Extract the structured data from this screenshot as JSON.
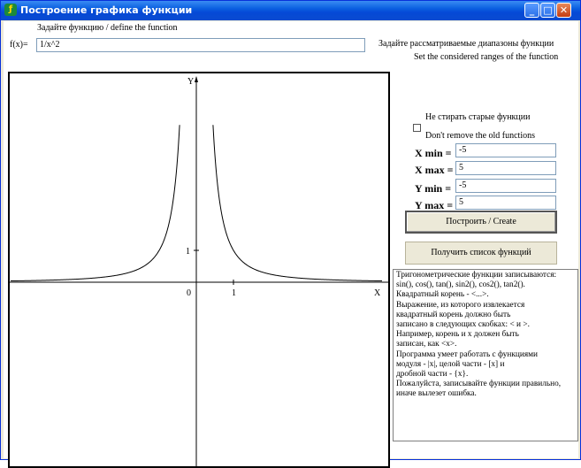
{
  "window": {
    "title": "Построение графика функции",
    "app_icon": "app-icon",
    "minimize_glyph": "_",
    "maximize_glyph": "□",
    "close_glyph": "✕"
  },
  "function": {
    "prompt": "Задайте функцию / define the function",
    "label": "f(x)=",
    "value": "1/x^2"
  },
  "ranges": {
    "heading_ru": "Задайте рассматриваемые диапазоны функции",
    "heading_en": "Set the considered ranges of the function",
    "keep_old_ru": "Не стирать старые функции",
    "keep_old_en": "Don't remove the old functions",
    "keep_old_checked": false,
    "xmin_label": "X min =",
    "xmin": "-5",
    "xmax_label": "X max =",
    "xmax": "5",
    "ymin_label": "Y min =",
    "ymin": "-5",
    "ymax_label": "Y max =",
    "ymax": "5"
  },
  "buttons": {
    "create": "Построить / Create",
    "list": "Получить список функций"
  },
  "graph": {
    "x_axis_label": "X",
    "y_axis_label": "Y",
    "origin_label": "0",
    "x_tick_label": "1",
    "y_tick_label": "1",
    "curve_color": "#000000"
  },
  "chart_data": {
    "type": "line",
    "function": "1/x^2",
    "xlim": [
      -5,
      5
    ],
    "ylim": [
      -5,
      5
    ],
    "x_ticks": [
      1
    ],
    "y_ticks": [
      1
    ],
    "series": [
      {
        "x": [
          -5,
          -4,
          -3,
          -2.5,
          -2,
          -1.5,
          -1,
          -0.8,
          -0.6,
          -0.5,
          -0.45
        ],
        "y": [
          0.04,
          0.0625,
          0.111,
          0.16,
          0.25,
          0.444,
          1,
          1.5625,
          2.778,
          4,
          4.94
        ]
      },
      {
        "x": [
          0.45,
          0.5,
          0.6,
          0.8,
          1,
          1.5,
          2,
          2.5,
          3,
          4,
          5
        ],
        "y": [
          4.94,
          4,
          2.778,
          1.5625,
          1,
          0.444,
          0.25,
          0.16,
          0.111,
          0.0625,
          0.04
        ]
      }
    ]
  },
  "help": {
    "lines": [
      "Тригонометрические функции записываются:",
      "sin(), cos(), tan(), sin2(), cos2(), tan2().",
      "Квадратный корень - <...>.",
      "Выражение, из которого извлекается",
      "квадратный корень должно быть",
      "записано в следующих скобках: < и >.",
      "Например, корень и x должен быть",
      "записан, как <x>.",
      "Программа умеет работать с функциями",
      "модуля - |x|, целой части - [x] и",
      "дробной части - {x}.",
      "Пожалуйста, записывайте функции правильно,",
      "иначе вылезет ошибка."
    ]
  }
}
